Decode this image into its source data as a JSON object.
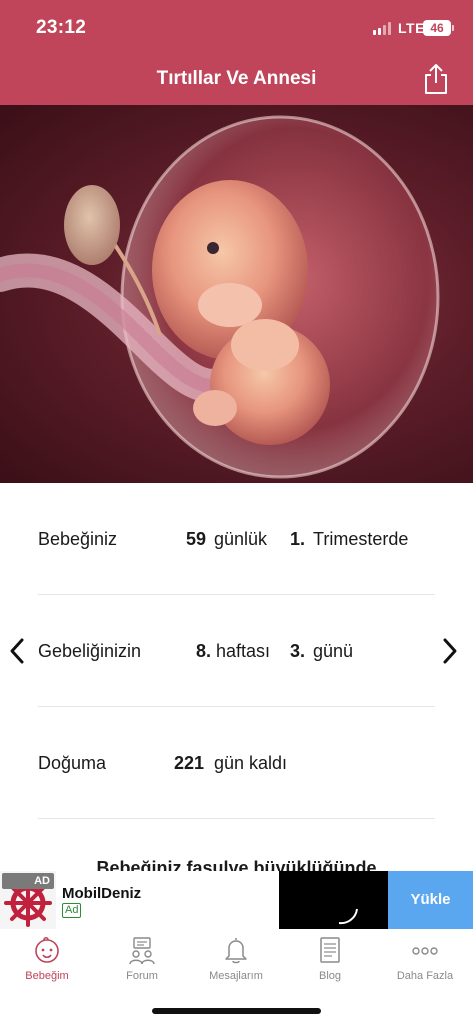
{
  "status_bar": {
    "time": "23:12",
    "network": "LTE",
    "battery": "46"
  },
  "header": {
    "title": "Tırtıllar Ve Annesi",
    "share_icon": "share-icon"
  },
  "hero": {
    "image": "embryo-illustration"
  },
  "rows": {
    "age": {
      "label": "Bebeğiniz",
      "days": "59",
      "days_unit": "günlük",
      "trimester": "1.",
      "trimester_label": "Trimesterde"
    },
    "week": {
      "label": "Gebeliğinizin",
      "week": "8.",
      "week_unit": "haftası",
      "day": "3.",
      "day_unit": "günü"
    },
    "birth": {
      "label": "Doğuma",
      "days_left": "221",
      "days_left_unit": "gün kaldı"
    }
  },
  "size_text": "Bebeğiniz fasulye büyüklüğünde",
  "ad": {
    "label": "AD",
    "app_name": "MobilDeniz",
    "badge": "Ad",
    "install": "Yükle"
  },
  "tabs": [
    {
      "label": "Bebeğim",
      "icon": "baby-face-icon",
      "active": true
    },
    {
      "label": "Forum",
      "icon": "forum-icon",
      "active": false
    },
    {
      "label": "Mesajlarım",
      "icon": "bell-icon",
      "active": false
    },
    {
      "label": "Blog",
      "icon": "blog-icon",
      "active": false
    },
    {
      "label": "Daha Fazla",
      "icon": "more-icon",
      "active": false
    }
  ],
  "colors": {
    "primary": "#c0445a",
    "ad_button": "#5aa7f0",
    "tab_inactive": "#8a8a8a"
  }
}
